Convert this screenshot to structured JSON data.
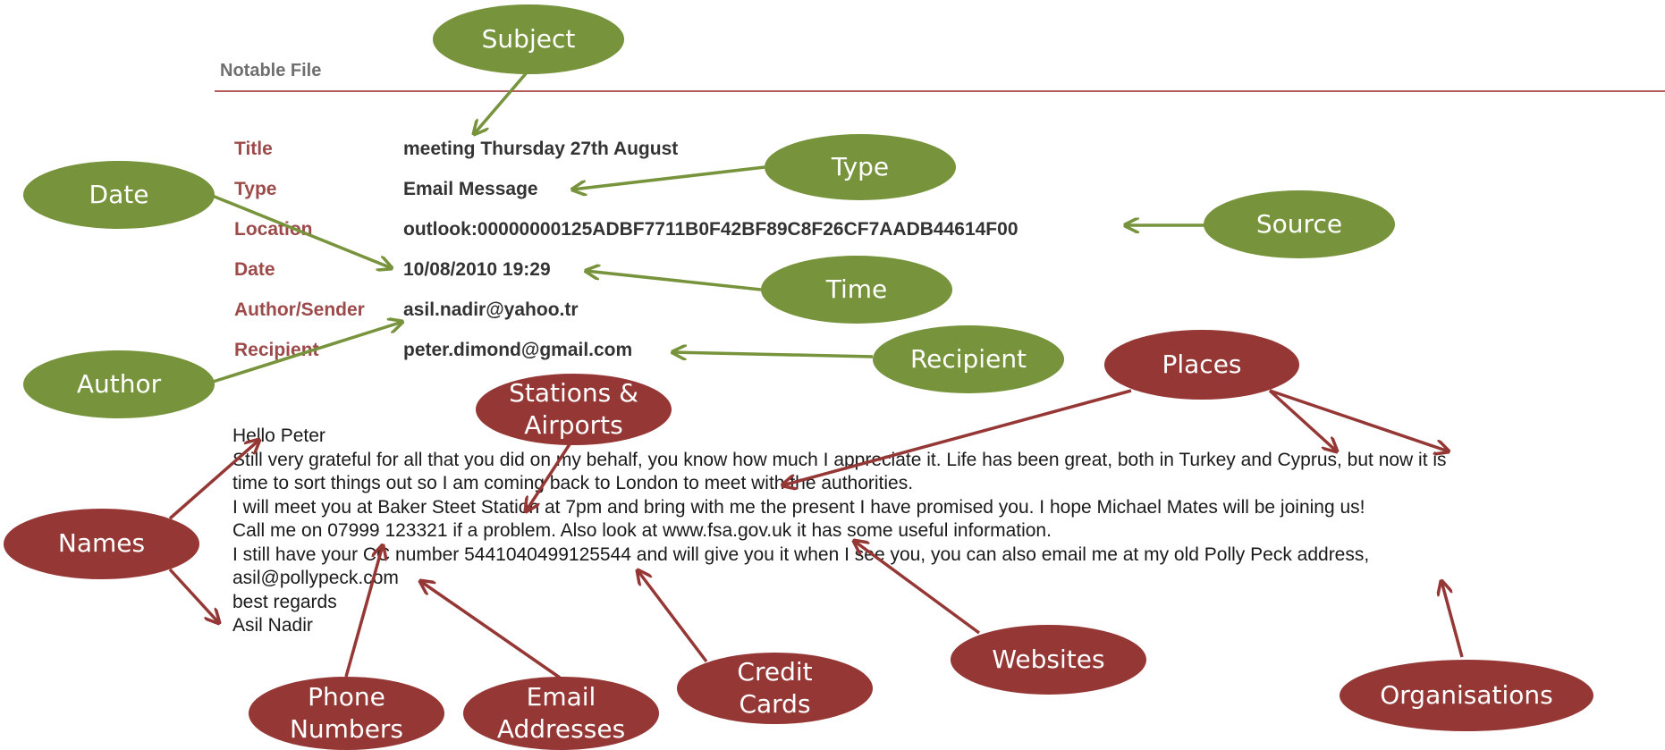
{
  "document": {
    "heading": "Notable File",
    "fields": [
      {
        "label": "Title",
        "value": "meeting Thursday 27th August"
      },
      {
        "label": "Type",
        "value": "Email Message"
      },
      {
        "label": "Location",
        "value": "outlook:00000000125ADBF7711B0F42BF89C8F26CF7AADB44614F00"
      },
      {
        "label": "Date",
        "value": "10/08/2010 19:29"
      },
      {
        "label": "Author/Sender",
        "value": "asil.nadir@yahoo.tr"
      },
      {
        "label": "Recipient",
        "value": "peter.dimond@gmail.com"
      }
    ],
    "body_lines": [
      "Hello Peter",
      "Still very grateful for all that you did on my behalf, you know how much I appreciate it. Life has been great, both in Turkey and Cyprus, but now it is",
      "time to sort things out so I am coming back to London to meet with the authorities.",
      "I will meet you at Baker Steet Station at 7pm and bring with me the present I have promised you. I hope Michael Mates will be joining us!",
      "Call me on 07999 123321 if a problem. Also look at www.fsa.gov.uk it has some useful information.",
      "I still have your CC number 5441040499125544 and will give you it when I see you, you can also email me at my old Polly Peck address,",
      "asil@pollypeck.com",
      "best regards",
      "Asil Nadir"
    ]
  },
  "callouts": {
    "subject": "Subject",
    "type": "Type",
    "date": "Date",
    "source": "Source",
    "time": "Time",
    "author": "Author",
    "recipient": "Recipient",
    "places": "Places",
    "stations": "Stations &\nAirports",
    "names": "Names",
    "phone": "Phone\nNumbers",
    "email": "Email\nAddresses",
    "credit": "Credit\nCards",
    "websites": "Websites",
    "organisations": "Organisations"
  },
  "colors": {
    "metadata_callout": "#77933c",
    "entity_callout": "#953735",
    "field_label": "#9c4a4a",
    "rule": "#b35a5a"
  }
}
